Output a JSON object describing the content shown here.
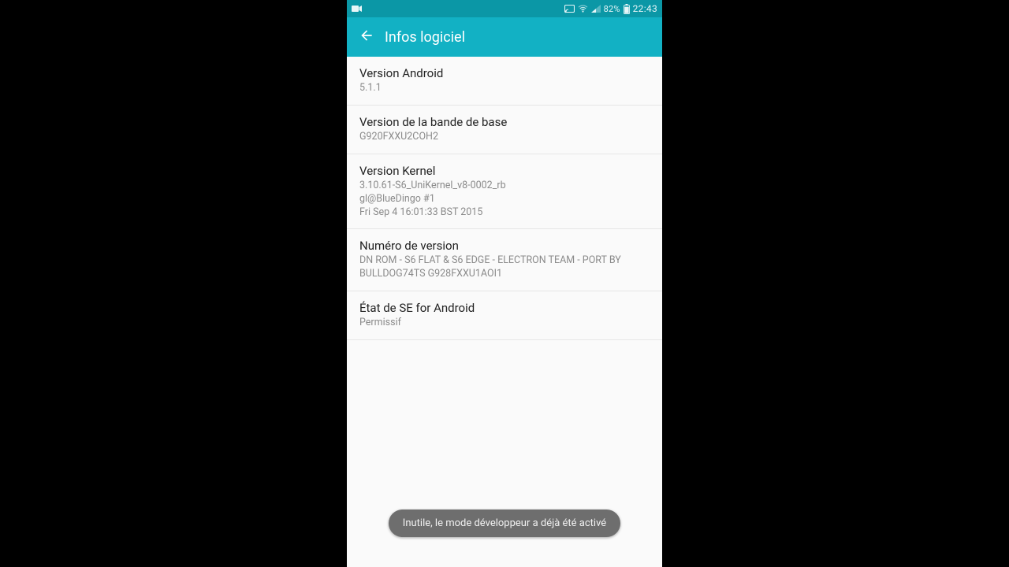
{
  "statusbar": {
    "battery_pct": "82%",
    "clock": "22:43"
  },
  "actionbar": {
    "title": "Infos logiciel"
  },
  "list": {
    "items": [
      {
        "title": "Version Android",
        "sub": "5.1.1"
      },
      {
        "title": "Version de la bande de base",
        "sub": "G920FXXU2COH2"
      },
      {
        "title": "Version Kernel",
        "sub": "3.10.61-S6_UniKernel_v8-0002_rb\ngl@BlueDingo #1\nFri Sep 4 16:01:33 BST 2015"
      },
      {
        "title": "Numéro de version",
        "sub": "DN ROM - S6 FLAT & S6 EDGE - ELECTRON TEAM - PORT BY BULLDOG74TS G928FXXU1AOI1"
      },
      {
        "title": "État de SE for Android",
        "sub": "Permissif"
      }
    ]
  },
  "toast": {
    "message": "Inutile, le mode développeur a déjà été activé"
  }
}
